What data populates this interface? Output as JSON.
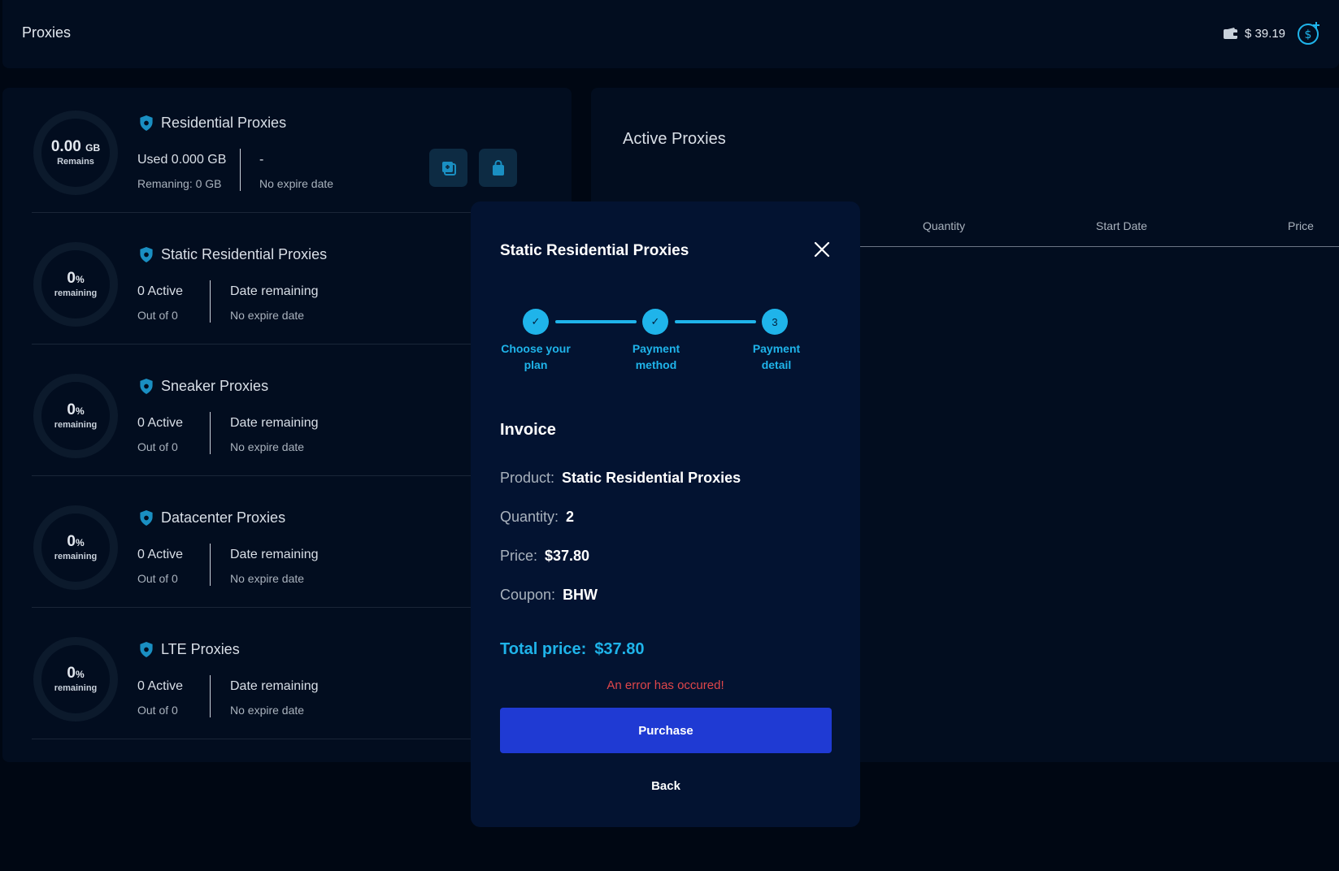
{
  "header": {
    "title": "Proxies",
    "balance": "$ 39.19",
    "wallet_icon": "wallet-icon",
    "add_funds_icon": "add-funds-icon"
  },
  "colors": {
    "accent": "#1fb4ea",
    "primary_button": "#1f3ad3",
    "error": "#e0464a",
    "background": "#000713",
    "panel": "#020d1f",
    "modal": "#031331"
  },
  "cards": [
    {
      "title": "Residential Proxies",
      "ring_main": "0.00",
      "ring_unit": "GB",
      "ring_sub": "Remains",
      "stat_a": "Used 0.000 GB",
      "stat_a_sub": "Remaning: 0 GB",
      "stat_b": "-",
      "stat_b_sub": "No expire date"
    },
    {
      "title": "Static Residential Proxies",
      "ring_main": "0",
      "ring_unit": "%",
      "ring_sub": "remaining",
      "stat_a": "0 Active",
      "stat_a_sub": "Out of 0",
      "stat_b": "Date remaining",
      "stat_b_sub": "No expire date"
    },
    {
      "title": "Sneaker Proxies",
      "ring_main": "0",
      "ring_unit": "%",
      "ring_sub": "remaining",
      "stat_a": "0 Active",
      "stat_a_sub": "Out of 0",
      "stat_b": "Date remaining",
      "stat_b_sub": "No expire date"
    },
    {
      "title": "Datacenter Proxies",
      "ring_main": "0",
      "ring_unit": "%",
      "ring_sub": "remaining",
      "stat_a": "0 Active",
      "stat_a_sub": "Out of 0",
      "stat_b": "Date remaining",
      "stat_b_sub": "No expire date"
    },
    {
      "title": "LTE Proxies",
      "ring_main": "0",
      "ring_unit": "%",
      "ring_sub": "remaining",
      "stat_a": "0 Active",
      "stat_a_sub": "Out of 0",
      "stat_b": "Date remaining",
      "stat_b_sub": "No expire date"
    }
  ],
  "active_proxies": {
    "title": "Active Proxies",
    "columns": [
      "Quantity",
      "Start Date",
      "Price"
    ]
  },
  "modal": {
    "title": "Static Residential Proxies",
    "steps": [
      {
        "label_line1": "Choose your",
        "label_line2": "plan",
        "marker": "✓"
      },
      {
        "label_line1": "Payment",
        "label_line2": "method",
        "marker": "✓"
      },
      {
        "label_line1": "Payment",
        "label_line2": "detail",
        "marker": "3"
      }
    ],
    "invoice_heading": "Invoice",
    "invoice": [
      {
        "label": "Product:",
        "value": "Static Residential Proxies"
      },
      {
        "label": "Quantity:",
        "value": "2"
      },
      {
        "label": "Price:",
        "value": "$37.80"
      },
      {
        "label": "Coupon:",
        "value": "BHW"
      }
    ],
    "total_label": "Total price:",
    "total_value": "$37.80",
    "error": "An error has occured!",
    "purchase_label": "Purchase",
    "back_label": "Back"
  }
}
